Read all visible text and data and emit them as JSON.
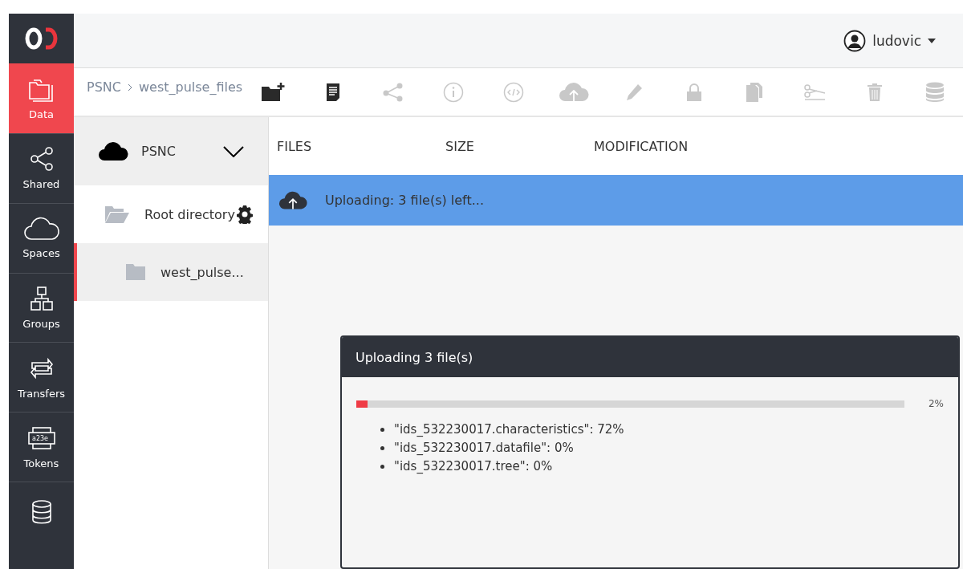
{
  "sidebar": {
    "items": [
      {
        "label": "Data",
        "selected": true
      },
      {
        "label": "Shared",
        "selected": false
      },
      {
        "label": "Spaces",
        "selected": false
      },
      {
        "label": "Groups",
        "selected": false
      },
      {
        "label": "Transfers",
        "selected": false
      },
      {
        "label": "Tokens",
        "selected": false,
        "icon_text": "a23e"
      }
    ]
  },
  "header": {
    "user": "ludovic"
  },
  "breadcrumb": [
    "PSNC",
    "west_pulse_files"
  ],
  "toolbar": [
    {
      "disabled": false
    },
    {
      "disabled": false
    },
    {
      "disabled": true
    },
    {
      "disabled": true
    },
    {
      "disabled": true
    },
    {
      "disabled": true
    },
    {
      "disabled": true
    },
    {
      "disabled": true
    },
    {
      "disabled": true
    },
    {
      "disabled": true
    },
    {
      "disabled": true
    },
    {
      "disabled": true
    }
  ],
  "space": {
    "name": "PSNC",
    "expanded": true
  },
  "tree": [
    {
      "label": "Root directory",
      "selected": false,
      "children": [
        {
          "label": "west_pulse...",
          "selected": true
        }
      ]
    }
  ],
  "table": {
    "columns": [
      "FILES",
      "SIZE",
      "MODIFICATION"
    ],
    "upload_row": "Uploading: 3 file(s) left..."
  },
  "upload_modal": {
    "title": "Uploading 3 file(s)",
    "level": 0.02,
    "reading": "2%",
    "files": [
      "\"ids_532230017.characteristics\": 72%",
      "\"ids_532230017.datafile\": 0%",
      "\"ids_532230017.tree\": 0%"
    ]
  }
}
